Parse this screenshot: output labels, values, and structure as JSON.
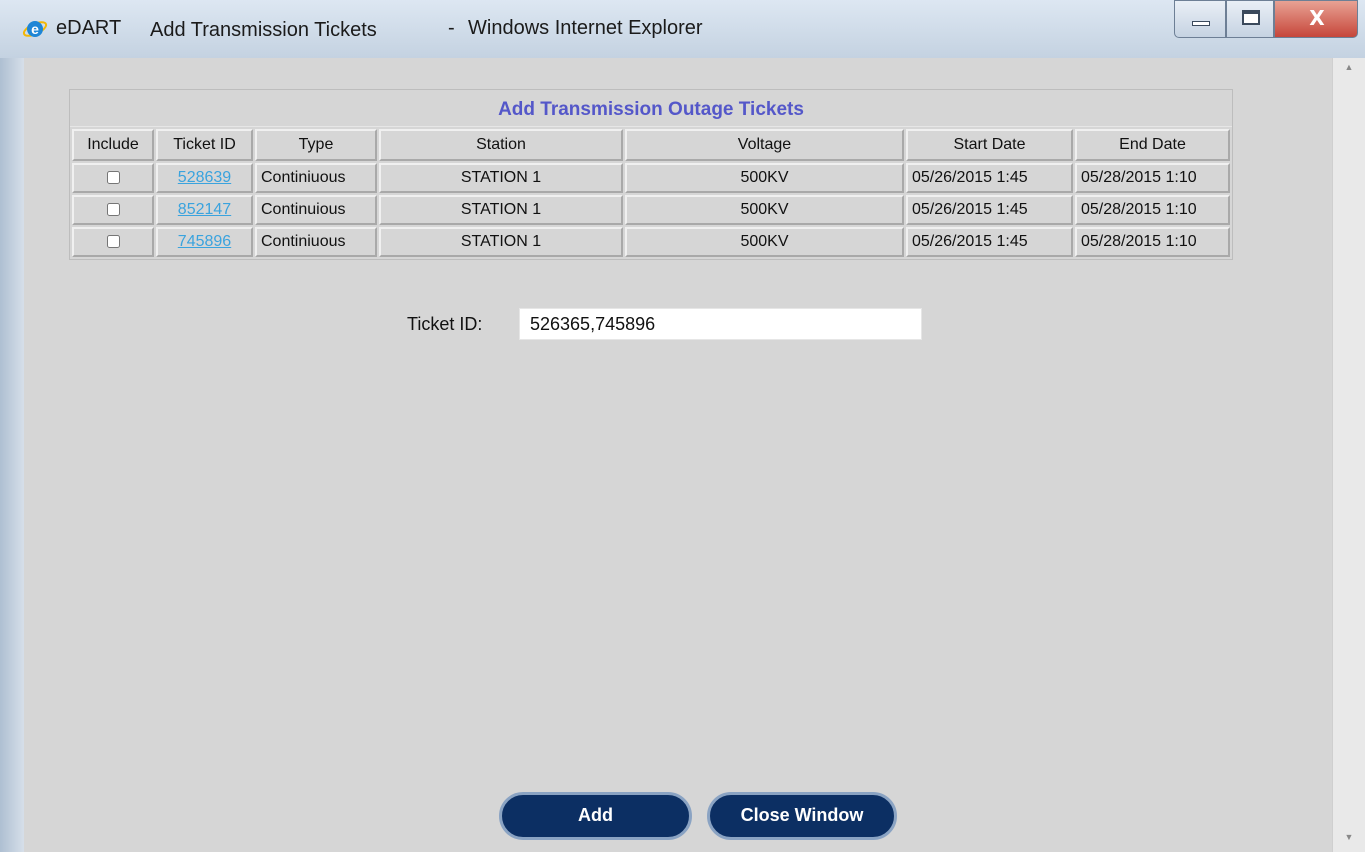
{
  "window": {
    "app_name": "eDART",
    "page_title": "Add Transmission Tickets",
    "separator": "-",
    "browser": "Windows Internet Explorer",
    "close_glyph": "X"
  },
  "icons": {
    "browser": "internet-explorer-icon",
    "minimize": "minimize-icon",
    "maximize": "maximize-icon",
    "close": "close-icon"
  },
  "tickets_table": {
    "title": "Add Transmission Outage Tickets",
    "columns": [
      "Include",
      "Ticket ID",
      "Type",
      "Station",
      "Voltage",
      "Start Date",
      "End Date"
    ],
    "rows": [
      {
        "ticket_id": "528639",
        "type": "Continiuous",
        "station": "STATION 1",
        "voltage": "500KV",
        "start": "05/26/2015 1:45",
        "end": "05/28/2015 1:10"
      },
      {
        "ticket_id": "852147",
        "type": "Continuious",
        "station": "STATION 1",
        "voltage": "500KV",
        "start": "05/26/2015 1:45",
        "end": "05/28/2015 1:10"
      },
      {
        "ticket_id": "745896",
        "type": "Continiuous",
        "station": "STATION 1",
        "voltage": "500KV",
        "start": "05/26/2015 1:45",
        "end": "05/28/2015 1:10"
      }
    ]
  },
  "ticket_field": {
    "label": "Ticket ID:",
    "value": "526365,745896"
  },
  "buttons": {
    "add": "Add",
    "close_window": "Close Window"
  },
  "colors": {
    "title_text": "#5457c9",
    "link": "#3aa3de",
    "button_bg": "#0c2f63"
  }
}
